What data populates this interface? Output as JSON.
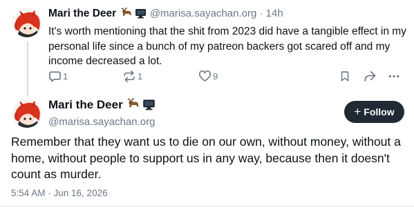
{
  "reply_context_post": {
    "author_name": "Mari the Deer",
    "badges": [
      "goat-emoji",
      "computer-emoji"
    ],
    "handle": "@marisa.sayachan.org",
    "separator": " · ",
    "time_ago": "14h",
    "body": "It's worth mentioning that the shit from 2023 did have a tangible effect in my personal life since a bunch of my patreon backers got scared off and my income decreased a lot.",
    "actions": {
      "replies": "1",
      "reposts": "1",
      "likes": "9"
    }
  },
  "main_post": {
    "author_name": "Mari the Deer",
    "badges": [
      "goat-emoji",
      "computer-emoji"
    ],
    "handle": "@marisa.sayachan.org",
    "follow_label": "Follow",
    "body": "Remember that they want us to die on our own, without money, without a home, without people to support us in any way, because then it doesn't count as murder.",
    "timestamp": "5:54 AM · Jun 16, 2026"
  },
  "colors": {
    "text": "#0b1117",
    "muted": "#6b7784",
    "follow_bg": "#1f2a35",
    "avatar_hair": "#d9331f"
  }
}
